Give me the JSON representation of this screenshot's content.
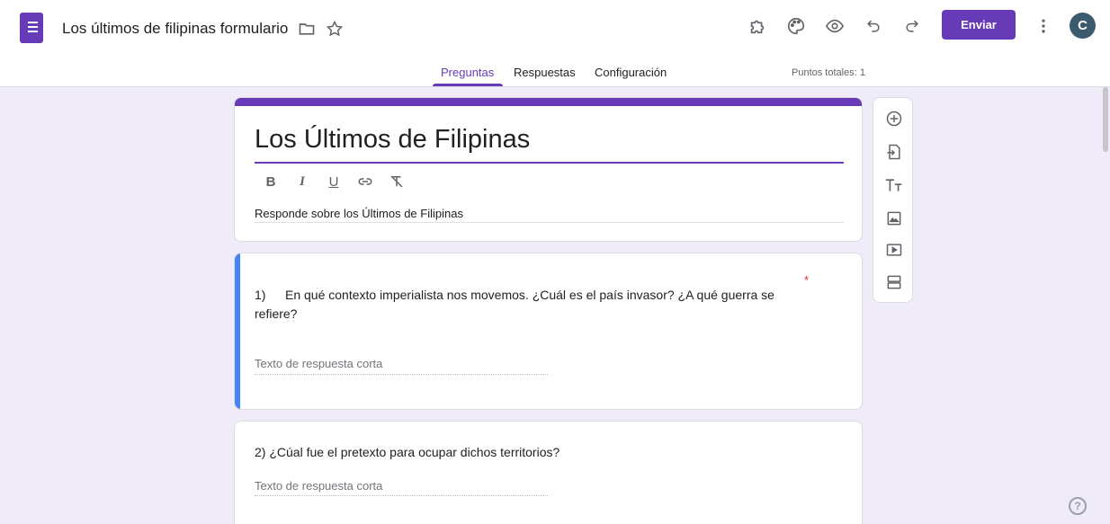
{
  "colors": {
    "accent": "#673ab7",
    "focus": "#4285f4",
    "required": "#d93025"
  },
  "header": {
    "doc_title": "Los últimos de filipinas formulario",
    "icons": [
      "folder-icon",
      "star-icon",
      "addon-icon",
      "palette-icon",
      "preview-icon",
      "undo-icon",
      "redo-icon",
      "more-vert-icon"
    ],
    "send_label": "Enviar",
    "avatar_initial": "C"
  },
  "tabs": [
    {
      "label": "Preguntas",
      "active": true
    },
    {
      "label": "Respuestas",
      "active": false
    },
    {
      "label": "Configuración",
      "active": false
    }
  ],
  "points_total": "Puntos totales: 1",
  "form": {
    "title": "Los Últimos de Filipinas",
    "format_tools": [
      "B",
      "I",
      "U",
      "link",
      "clear-format"
    ],
    "description": "Responde sobre los Últimos de Filipinas"
  },
  "questions": [
    {
      "number": "1)",
      "text": "En qué contexto imperialista nos movemos. ¿Cuál es el país invasor? ¿A qué guerra se refiere?",
      "required_mark": "*",
      "answer_placeholder": "Texto de respuesta corta"
    },
    {
      "text": "2) ¿Cúal fue el pretexto para ocupar dichos territorios?",
      "answer_placeholder": "Texto de respuesta corta"
    }
  ],
  "side_tools": [
    "add-question-icon",
    "import-questions-icon",
    "add-title-icon",
    "add-image-icon",
    "add-video-icon",
    "add-section-icon"
  ],
  "help_glyph": "?"
}
